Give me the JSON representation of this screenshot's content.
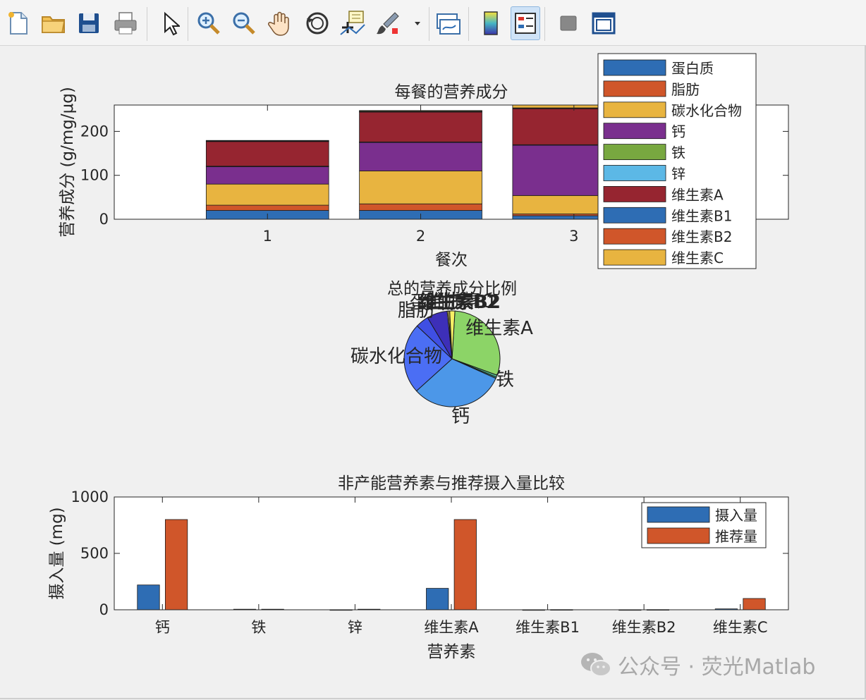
{
  "toolbar": {
    "buttons": [
      {
        "name": "new-figure-button",
        "icon": "new-file-icon"
      },
      {
        "name": "open-file-button",
        "icon": "folder-icon"
      },
      {
        "name": "save-button",
        "icon": "floppy-disk-icon"
      },
      {
        "name": "print-button",
        "icon": "printer-icon"
      },
      {
        "name": "edit-plot-button",
        "icon": "arrow-cursor-icon"
      },
      {
        "name": "zoom-in-button",
        "icon": "zoom-in-icon"
      },
      {
        "name": "zoom-out-button",
        "icon": "zoom-out-icon"
      },
      {
        "name": "pan-button",
        "icon": "hand-icon"
      },
      {
        "name": "rotate-3d-button",
        "icon": "rotate-icon"
      },
      {
        "name": "data-cursor-button",
        "icon": "data-tip-icon"
      },
      {
        "name": "brush-button",
        "icon": "brush-icon"
      },
      {
        "name": "link-plot-button",
        "icon": "link-plot-icon"
      },
      {
        "name": "colorbar-button",
        "icon": "colorbar-icon"
      },
      {
        "name": "legend-button",
        "icon": "legend-icon"
      },
      {
        "name": "hide-plot-tools-button",
        "icon": "hide-tools-icon"
      },
      {
        "name": "show-plot-tools-button",
        "icon": "plot-tools-icon"
      }
    ]
  },
  "watermark": {
    "text": "公众号 · 荧光Matlab",
    "icon": "wechat-icon"
  },
  "colors": {
    "protein": "#2e6db4",
    "fat": "#d0562a",
    "carbs": "#e8b440",
    "calcium": "#7a2f8e",
    "iron": "#78a840",
    "zinc": "#5cb8e6",
    "vitA": "#962530",
    "vitB1": "#2e6db4",
    "vitB2": "#d0562a",
    "vitC": "#e8b440"
  },
  "chart_data": [
    {
      "type": "bar",
      "stacked": true,
      "title": "每餐的营养成分",
      "xlabel": "餐次",
      "ylabel": "营养成分 (g/mg/μg)",
      "xlim": [
        0,
        4.4
      ],
      "ylim": [
        0,
        260
      ],
      "yticks": [
        0,
        100,
        200
      ],
      "categories": [
        "1",
        "2",
        "3"
      ],
      "legend_position": "top-right",
      "series": [
        {
          "name": "蛋白质",
          "color": "#2e6db4",
          "values": [
            20,
            20,
            8
          ]
        },
        {
          "name": "脂肪",
          "color": "#d0562a",
          "values": [
            12,
            15,
            4
          ]
        },
        {
          "name": "碳水化合物",
          "color": "#e8b440",
          "values": [
            48,
            75,
            42
          ]
        },
        {
          "name": "钙",
          "color": "#7a2f8e",
          "values": [
            40,
            65,
            115
          ]
        },
        {
          "name": "铁",
          "color": "#78a840",
          "values": [
            0.5,
            0.6,
            0.4
          ]
        },
        {
          "name": "锌",
          "color": "#5cb8e6",
          "values": [
            0.4,
            0.4,
            0.3
          ]
        },
        {
          "name": "维生素A",
          "color": "#962530",
          "values": [
            56,
            68,
            82
          ]
        },
        {
          "name": "维生素B1",
          "color": "#2e6db4",
          "values": [
            1.0,
            1.0,
            0.9
          ]
        },
        {
          "name": "维生素B2",
          "color": "#d0562a",
          "values": [
            1.0,
            1.0,
            0.9
          ]
        },
        {
          "name": "维生素C",
          "color": "#e8b440",
          "values": [
            0.5,
            1.5,
            10
          ]
        }
      ]
    },
    {
      "type": "pie",
      "title": "总的营养成分比例",
      "slices": [
        {
          "label": "维生素A",
          "value": 206,
          "color": "#8cd467"
        },
        {
          "label": "铁",
          "value": 5,
          "color": "#4fb58e"
        },
        {
          "label": "",
          "value": 3,
          "color": "#46aaa6"
        },
        {
          "label": "钙",
          "value": 220,
          "color": "#4c97e8"
        },
        {
          "label": "碳水化合物",
          "value": 165,
          "color": "#4b6ef4"
        },
        {
          "label": "脂肪",
          "value": 31,
          "color": "#3f4fe3"
        },
        {
          "label": "蛋白质",
          "value": 48,
          "color": "#3d2fb8"
        },
        {
          "label": "维生素B1",
          "value": 3,
          "color": "#f2ef6e"
        },
        {
          "label": "维生素B2",
          "value": 3,
          "color": "#ffe95a"
        },
        {
          "label": "维生素C",
          "value": 12,
          "color": "#f7f065"
        }
      ],
      "overlap_label": "维生素B2"
    },
    {
      "type": "bar",
      "title": "非产能营养素与推荐摄入量比较",
      "xlabel": "营养素",
      "ylabel": "摄入量 (mg)",
      "ylim": [
        0,
        1000
      ],
      "yticks": [
        0,
        500,
        1000
      ],
      "categories": [
        "钙",
        "铁",
        "锌",
        "维生素A",
        "维生素B1",
        "维生素B2",
        "维生素C"
      ],
      "legend_position": "top-right",
      "series": [
        {
          "name": "摄入量",
          "color": "#2e6db4",
          "values": [
            220,
            5,
            0.5,
            190,
            0.4,
            0.5,
            8
          ]
        },
        {
          "name": "推荐量",
          "color": "#d0562a",
          "values": [
            800,
            5,
            5,
            800,
            1.4,
            1.4,
            100
          ]
        }
      ]
    }
  ]
}
